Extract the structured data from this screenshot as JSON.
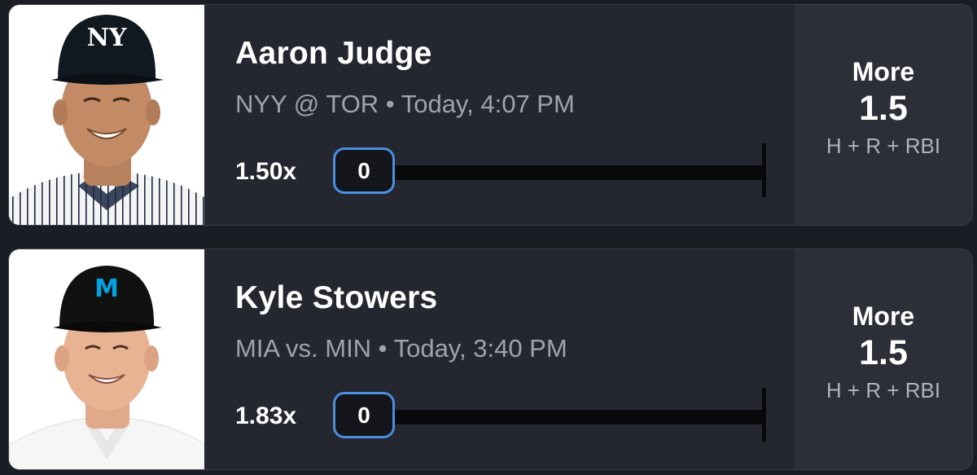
{
  "cards": [
    {
      "player": "Aaron Judge",
      "game": "NYY @ TOR • Today, 4:07 PM",
      "multiplier": "1.50x",
      "current": "0",
      "direction": "More",
      "line": "1.5",
      "stat": "H + R + RBI",
      "progress_fraction": 0,
      "team_colors": {
        "cap": "#101820",
        "jersey": "#f4f4f4",
        "pinstripe": "#1c2841"
      }
    },
    {
      "player": "Kyle Stowers",
      "game": "MIA vs. MIN • Today, 3:40 PM",
      "multiplier": "1.83x",
      "current": "0",
      "direction": "More",
      "line": "1.5",
      "stat": "H + R + RBI",
      "progress_fraction": 0,
      "team_colors": {
        "cap": "#111111",
        "jersey": "#f6f6f6",
        "logo": "#00a3e0"
      }
    }
  ],
  "icons": {
    "card1_logo": "ny-logo-icon",
    "card2_logo": "m-logo-icon"
  },
  "colors": {
    "background": "#1a1d23",
    "card": "#24272f",
    "side_panel": "#2c2f37",
    "pill_border": "#4a8fe0",
    "muted_text": "#9ea3ad"
  }
}
